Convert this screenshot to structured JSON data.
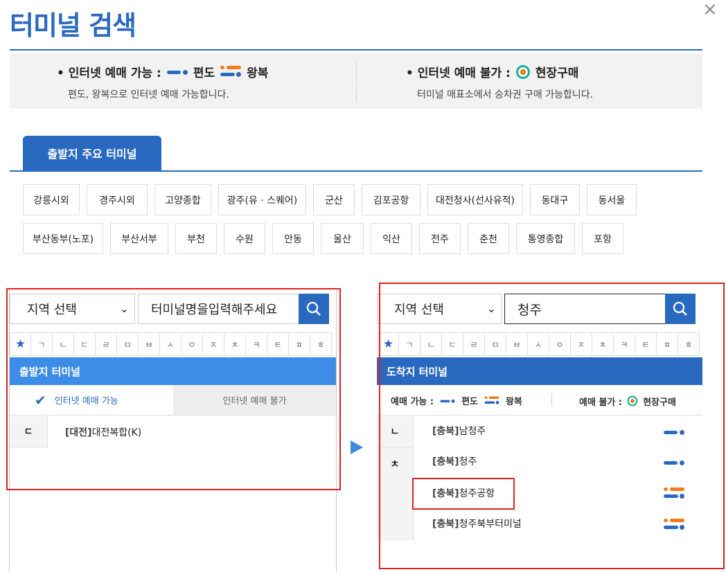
{
  "title": "터미널 검색",
  "info": {
    "online_head": "• 인터넷 예매 가능 :",
    "oneway_label": "편도",
    "round_label": "왕복",
    "online_sub": "편도, 왕복으로 인터넷 예매 가능합니다.",
    "offline_head": "• 인터넷 예매 불가 :",
    "onsite_label": "현장구매",
    "offline_sub": "터미널 매표소에서 승차권 구매 가능합니다."
  },
  "tab_label": "출발지 주요 터미널",
  "terminals_row1": [
    "강릉시외",
    "경주시외",
    "고양종합",
    "광주(유 · 스퀘어)",
    "군산",
    "김포공항",
    "대전청사(선사유적)",
    "동대구",
    "동서울"
  ],
  "terminals_row2": [
    "부산동부(노포)",
    "부산서부",
    "부천",
    "수원",
    "안동",
    "울산",
    "익산",
    "전주",
    "춘천",
    "통영종합",
    "포항"
  ],
  "consonants": [
    "★",
    "ㄱ",
    "ㄴ",
    "ㄷ",
    "ㄹ",
    "ㅁ",
    "ㅂ",
    "ㅅ",
    "ㅇ",
    "ㅈ",
    "ㅊ",
    "ㅋ",
    "ㅌ",
    "ㅍ",
    "ㅎ"
  ],
  "left": {
    "region": "지역 선택",
    "search_placeholder": "터미널명을입력해주세요",
    "bar": "출발지 터미널",
    "tab_online": "인터넷 예매 가능",
    "tab_offline": "인터넷 예매 불가",
    "group": "ㄷ",
    "item_region": "[대전]",
    "item_name": "대전복합(K)"
  },
  "right": {
    "region": "지역 선택",
    "search_value": "청주",
    "bar": "도착지 터미널",
    "legend_online": "예매 가능 :",
    "legend_oneway": "편도",
    "legend_round": "왕복",
    "legend_offline": "예매 불가 :",
    "legend_onsite": "현장구매",
    "groups": [
      "ㄴ",
      "ㅊ"
    ],
    "items": [
      {
        "region": "[충북]",
        "name": "남청주",
        "type": "oneway"
      },
      {
        "region": "[충북]",
        "name": "청주",
        "type": "oneway"
      },
      {
        "region": "[충북]",
        "name": "청주공항",
        "type": "round"
      },
      {
        "region": "[충북]",
        "name": "청주북부터미널",
        "type": "round"
      }
    ]
  }
}
